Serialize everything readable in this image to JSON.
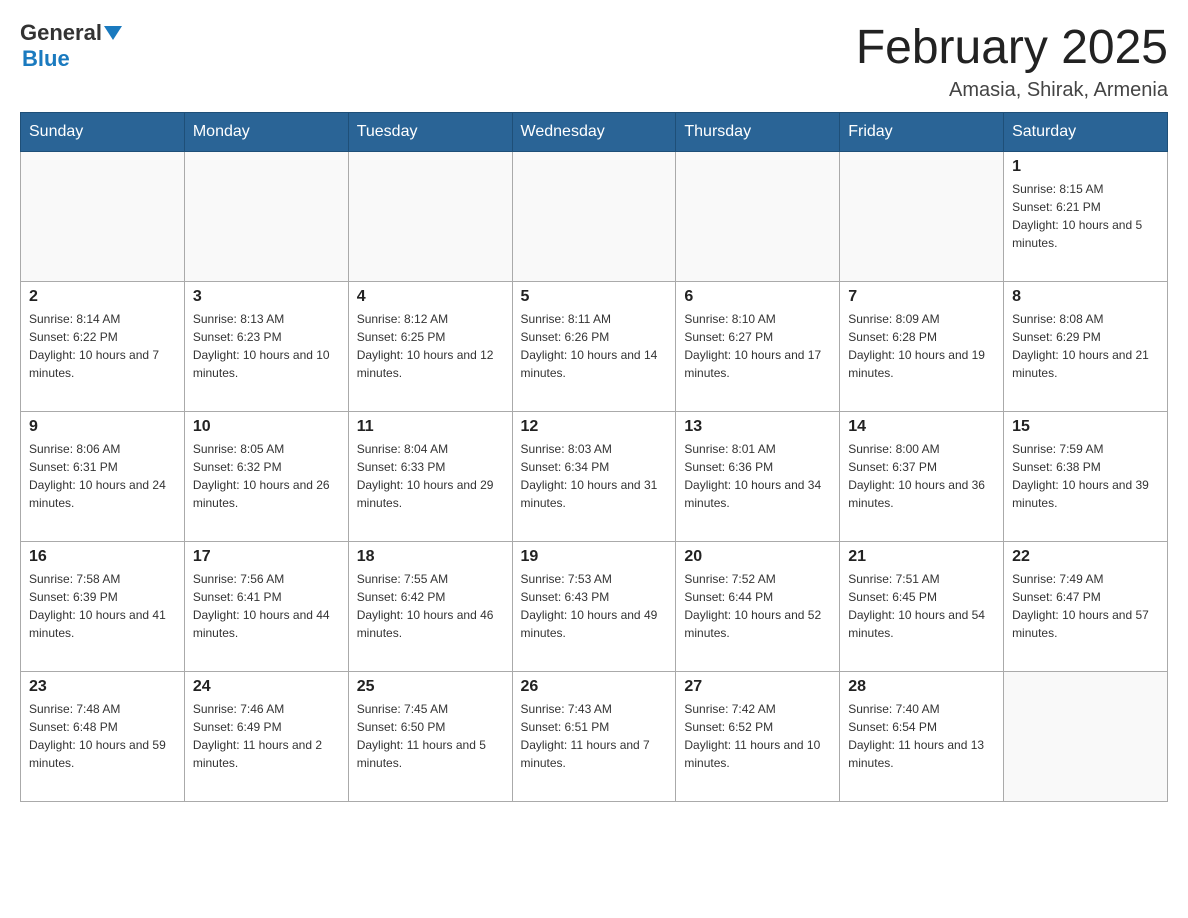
{
  "header": {
    "logo": {
      "general": "General",
      "blue": "Blue"
    },
    "title": "February 2025",
    "location": "Amasia, Shirak, Armenia"
  },
  "weekdays": [
    "Sunday",
    "Monday",
    "Tuesday",
    "Wednesday",
    "Thursday",
    "Friday",
    "Saturday"
  ],
  "weeks": [
    [
      {
        "day": "",
        "info": ""
      },
      {
        "day": "",
        "info": ""
      },
      {
        "day": "",
        "info": ""
      },
      {
        "day": "",
        "info": ""
      },
      {
        "day": "",
        "info": ""
      },
      {
        "day": "",
        "info": ""
      },
      {
        "day": "1",
        "info": "Sunrise: 8:15 AM\nSunset: 6:21 PM\nDaylight: 10 hours and 5 minutes."
      }
    ],
    [
      {
        "day": "2",
        "info": "Sunrise: 8:14 AM\nSunset: 6:22 PM\nDaylight: 10 hours and 7 minutes."
      },
      {
        "day": "3",
        "info": "Sunrise: 8:13 AM\nSunset: 6:23 PM\nDaylight: 10 hours and 10 minutes."
      },
      {
        "day": "4",
        "info": "Sunrise: 8:12 AM\nSunset: 6:25 PM\nDaylight: 10 hours and 12 minutes."
      },
      {
        "day": "5",
        "info": "Sunrise: 8:11 AM\nSunset: 6:26 PM\nDaylight: 10 hours and 14 minutes."
      },
      {
        "day": "6",
        "info": "Sunrise: 8:10 AM\nSunset: 6:27 PM\nDaylight: 10 hours and 17 minutes."
      },
      {
        "day": "7",
        "info": "Sunrise: 8:09 AM\nSunset: 6:28 PM\nDaylight: 10 hours and 19 minutes."
      },
      {
        "day": "8",
        "info": "Sunrise: 8:08 AM\nSunset: 6:29 PM\nDaylight: 10 hours and 21 minutes."
      }
    ],
    [
      {
        "day": "9",
        "info": "Sunrise: 8:06 AM\nSunset: 6:31 PM\nDaylight: 10 hours and 24 minutes."
      },
      {
        "day": "10",
        "info": "Sunrise: 8:05 AM\nSunset: 6:32 PM\nDaylight: 10 hours and 26 minutes."
      },
      {
        "day": "11",
        "info": "Sunrise: 8:04 AM\nSunset: 6:33 PM\nDaylight: 10 hours and 29 minutes."
      },
      {
        "day": "12",
        "info": "Sunrise: 8:03 AM\nSunset: 6:34 PM\nDaylight: 10 hours and 31 minutes."
      },
      {
        "day": "13",
        "info": "Sunrise: 8:01 AM\nSunset: 6:36 PM\nDaylight: 10 hours and 34 minutes."
      },
      {
        "day": "14",
        "info": "Sunrise: 8:00 AM\nSunset: 6:37 PM\nDaylight: 10 hours and 36 minutes."
      },
      {
        "day": "15",
        "info": "Sunrise: 7:59 AM\nSunset: 6:38 PM\nDaylight: 10 hours and 39 minutes."
      }
    ],
    [
      {
        "day": "16",
        "info": "Sunrise: 7:58 AM\nSunset: 6:39 PM\nDaylight: 10 hours and 41 minutes."
      },
      {
        "day": "17",
        "info": "Sunrise: 7:56 AM\nSunset: 6:41 PM\nDaylight: 10 hours and 44 minutes."
      },
      {
        "day": "18",
        "info": "Sunrise: 7:55 AM\nSunset: 6:42 PM\nDaylight: 10 hours and 46 minutes."
      },
      {
        "day": "19",
        "info": "Sunrise: 7:53 AM\nSunset: 6:43 PM\nDaylight: 10 hours and 49 minutes."
      },
      {
        "day": "20",
        "info": "Sunrise: 7:52 AM\nSunset: 6:44 PM\nDaylight: 10 hours and 52 minutes."
      },
      {
        "day": "21",
        "info": "Sunrise: 7:51 AM\nSunset: 6:45 PM\nDaylight: 10 hours and 54 minutes."
      },
      {
        "day": "22",
        "info": "Sunrise: 7:49 AM\nSunset: 6:47 PM\nDaylight: 10 hours and 57 minutes."
      }
    ],
    [
      {
        "day": "23",
        "info": "Sunrise: 7:48 AM\nSunset: 6:48 PM\nDaylight: 10 hours and 59 minutes."
      },
      {
        "day": "24",
        "info": "Sunrise: 7:46 AM\nSunset: 6:49 PM\nDaylight: 11 hours and 2 minutes."
      },
      {
        "day": "25",
        "info": "Sunrise: 7:45 AM\nSunset: 6:50 PM\nDaylight: 11 hours and 5 minutes."
      },
      {
        "day": "26",
        "info": "Sunrise: 7:43 AM\nSunset: 6:51 PM\nDaylight: 11 hours and 7 minutes."
      },
      {
        "day": "27",
        "info": "Sunrise: 7:42 AM\nSunset: 6:52 PM\nDaylight: 11 hours and 10 minutes."
      },
      {
        "day": "28",
        "info": "Sunrise: 7:40 AM\nSunset: 6:54 PM\nDaylight: 11 hours and 13 minutes."
      },
      {
        "day": "",
        "info": ""
      }
    ]
  ]
}
